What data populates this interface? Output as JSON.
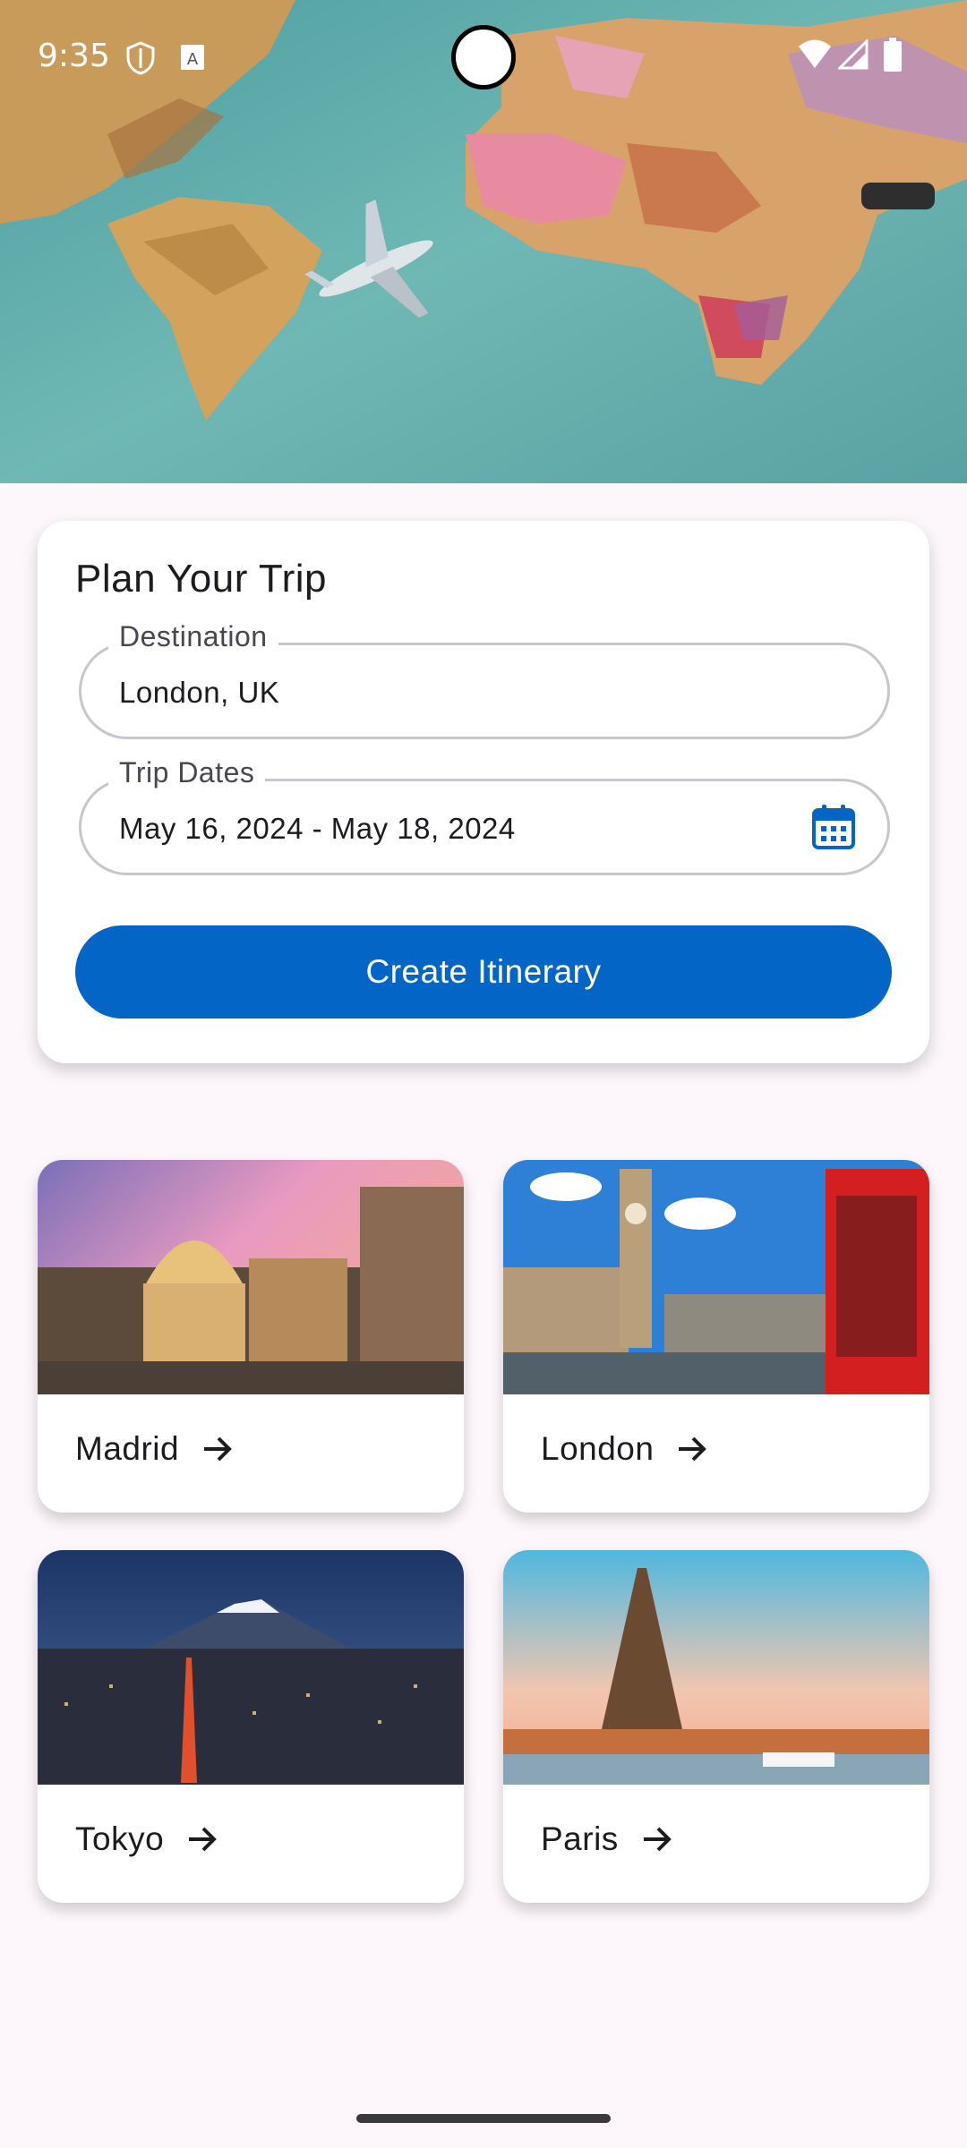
{
  "status_bar": {
    "time": "9:35"
  },
  "plan": {
    "title": "Plan Your Trip",
    "destination": {
      "label": "Destination",
      "value": "London, UK"
    },
    "dates": {
      "label": "Trip Dates",
      "value": "May 16, 2024 - May 18, 2024"
    },
    "cta_label": "Create Itinerary"
  },
  "destinations": [
    {
      "name": "Madrid"
    },
    {
      "name": "London"
    },
    {
      "name": "Tokyo"
    },
    {
      "name": "Paris"
    }
  ],
  "colors": {
    "accent": "#0366c6",
    "background": "#fdf7fb"
  }
}
